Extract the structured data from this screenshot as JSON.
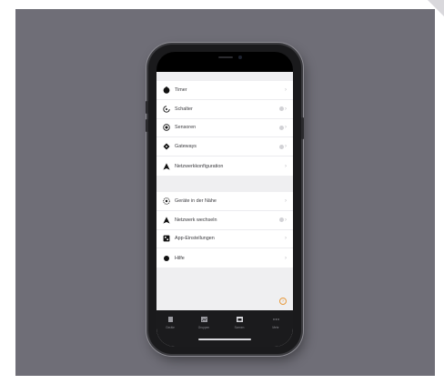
{
  "menu": {
    "items": [
      {
        "label": "Timer",
        "icon": "stopwatch-icon"
      },
      {
        "label": "Schalter",
        "icon": "switch-icon",
        "badge": true
      },
      {
        "label": "Sensoren",
        "icon": "sensor-icon",
        "badge": true
      },
      {
        "label": "Gateways",
        "icon": "gateway-icon",
        "badge": true
      },
      {
        "label": "Netzwerkkonfiguration",
        "icon": "network-icon"
      }
    ],
    "secondary": [
      {
        "label": "Geräte in der Nähe",
        "icon": "nearby-devices-icon"
      },
      {
        "label": "Netzwerk wechseln",
        "icon": "network-switch-icon",
        "badge": true
      },
      {
        "label": "App-Einstellungen",
        "icon": "app-settings-icon"
      },
      {
        "label": "Hilfe",
        "icon": "help-circle-icon"
      }
    ],
    "chevron": "›"
  },
  "help_glyph": "?",
  "tabbar": {
    "tabs": [
      {
        "label": "Geräte",
        "icon": "devices-tab-icon"
      },
      {
        "label": "Gruppen",
        "icon": "groups-tab-icon"
      },
      {
        "label": "Szenen",
        "icon": "scenes-tab-icon"
      },
      {
        "label": "Mehr",
        "icon": "more-tab-icon"
      }
    ]
  },
  "colors": {
    "backdrop": "#6f6e77",
    "phone_frame": "#1a1a1c",
    "accent_help": "#e89a3c"
  }
}
